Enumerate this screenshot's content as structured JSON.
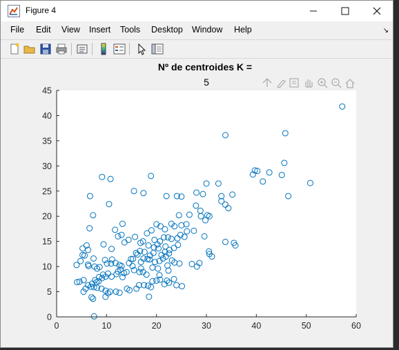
{
  "window": {
    "title": "Figure 4",
    "minimize_icon": "minimize-icon",
    "maximize_icon": "maximize-icon",
    "close_icon": "close-icon"
  },
  "menubar": {
    "items": [
      "File",
      "Edit",
      "View",
      "Insert",
      "Tools",
      "Desktop",
      "Window",
      "Help"
    ],
    "dock_arrow": "↘"
  },
  "toolbar": {
    "icons": [
      "new-figure-icon",
      "open-file-icon",
      "save-icon",
      "print-icon",
      "link-plot-icon",
      "insert-colorbar-icon",
      "insert-legend-icon",
      "edit-plot-icon",
      "property-inspector-icon"
    ]
  },
  "axes_toolbar": {
    "icons": [
      "export-icon",
      "brush-icon",
      "data-tips-icon",
      "pan-icon",
      "zoom-in-icon",
      "zoom-out-icon",
      "home-icon"
    ]
  },
  "colors": {
    "marker": "#0072BD",
    "axes_bg": "#ffffff",
    "figure_bg": "#f0f0f0"
  },
  "chart_data": {
    "type": "scatter",
    "title": "Nº de centroides K =",
    "subtitle": "5",
    "xlim": [
      0,
      60
    ],
    "ylim": [
      0,
      45
    ],
    "xticks": [
      "0",
      "10",
      "20",
      "30",
      "40",
      "50",
      "60"
    ],
    "yticks": [
      "0",
      "5",
      "10",
      "15",
      "20",
      "25",
      "30",
      "35",
      "40",
      "45"
    ],
    "marker": "open-circle",
    "points": [
      [
        57.2,
        41.8
      ],
      [
        45.8,
        36.5
      ],
      [
        33.8,
        36.1
      ],
      [
        45.6,
        30.6
      ],
      [
        39.7,
        29.1
      ],
      [
        40.2,
        29.0
      ],
      [
        42.6,
        28.7
      ],
      [
        39.3,
        28.3
      ],
      [
        45.1,
        28.2
      ],
      [
        30.0,
        26.5
      ],
      [
        32.4,
        26.5
      ],
      [
        41.3,
        26.9
      ],
      [
        50.8,
        26.6
      ],
      [
        33.0,
        24.0
      ],
      [
        35.2,
        24.3
      ],
      [
        46.4,
        24.0
      ],
      [
        33.0,
        23.0
      ],
      [
        33.8,
        22.3
      ],
      [
        34.4,
        21.6
      ],
      [
        28.0,
        24.7
      ],
      [
        29.3,
        24.4
      ],
      [
        27.9,
        22.1
      ],
      [
        28.8,
        21.1
      ],
      [
        28.9,
        20.0
      ],
      [
        30.2,
        20.2
      ],
      [
        29.8,
        19.2
      ],
      [
        30.6,
        20.0
      ],
      [
        29.6,
        16.0
      ],
      [
        33.8,
        14.9
      ],
      [
        35.5,
        14.7
      ],
      [
        35.8,
        14.2
      ],
      [
        30.6,
        12.5
      ],
      [
        30.5,
        13.0
      ],
      [
        31.1,
        12.0
      ],
      [
        28.6,
        10.7
      ],
      [
        28.1,
        10.0
      ],
      [
        27.1,
        10.5
      ],
      [
        25.0,
        23.9
      ],
      [
        24.1,
        24.0
      ],
      [
        22.0,
        24.0
      ],
      [
        17.4,
        24.6
      ],
      [
        15.5,
        25.0
      ],
      [
        18.9,
        28.0
      ],
      [
        9.1,
        27.8
      ],
      [
        10.8,
        27.4
      ],
      [
        6.7,
        24.0
      ],
      [
        10.5,
        22.4
      ],
      [
        7.3,
        20.2
      ],
      [
        6.6,
        17.6
      ],
      [
        11.7,
        17.3
      ],
      [
        13.2,
        18.5
      ],
      [
        20.0,
        18.4
      ],
      [
        20.8,
        18.0
      ],
      [
        21.7,
        17.4
      ],
      [
        23.0,
        18.5
      ],
      [
        23.6,
        18.0
      ],
      [
        25.0,
        18.2
      ],
      [
        26.0,
        18.4
      ],
      [
        24.5,
        20.2
      ],
      [
        26.6,
        20.3
      ],
      [
        27.5,
        17.1
      ],
      [
        26.1,
        17.0
      ],
      [
        24.8,
        16.3
      ],
      [
        25.6,
        15.9
      ],
      [
        24.2,
        15.6
      ],
      [
        23.0,
        15.5
      ],
      [
        22.3,
        15.8
      ],
      [
        21.5,
        15.8
      ],
      [
        20.7,
        15.0
      ],
      [
        20.2,
        14.4
      ],
      [
        19.6,
        15.3
      ],
      [
        19.0,
        17.2
      ],
      [
        18.1,
        16.6
      ],
      [
        17.3,
        15.0
      ],
      [
        16.8,
        14.7
      ],
      [
        18.4,
        14.2
      ],
      [
        19.5,
        13.8
      ],
      [
        20.4,
        13.6
      ],
      [
        21.8,
        14.0
      ],
      [
        22.6,
        13.3
      ],
      [
        23.5,
        13.7
      ],
      [
        24.3,
        14.3
      ],
      [
        21.0,
        12.3
      ],
      [
        21.7,
        12.9
      ],
      [
        22.5,
        12.6
      ],
      [
        23.1,
        11.2
      ],
      [
        23.6,
        10.8
      ],
      [
        24.6,
        10.6
      ],
      [
        22.2,
        10.2
      ],
      [
        22.4,
        9.2
      ],
      [
        20.3,
        9.6
      ],
      [
        19.2,
        9.8
      ],
      [
        18.6,
        11.4
      ],
      [
        18.2,
        11.5
      ],
      [
        17.4,
        11.6
      ],
      [
        16.9,
        10.9
      ],
      [
        16.2,
        12.4
      ],
      [
        15.9,
        12.7
      ],
      [
        16.7,
        13.1
      ],
      [
        17.6,
        12.9
      ],
      [
        19.4,
        12.7
      ],
      [
        18.7,
        12.2
      ],
      [
        15.7,
        15.9
      ],
      [
        14.4,
        15.3
      ],
      [
        13.6,
        14.8
      ],
      [
        12.3,
        16.0
      ],
      [
        13.0,
        16.3
      ],
      [
        11.0,
        13.5
      ],
      [
        9.4,
        14.4
      ],
      [
        6.0,
        14.2
      ],
      [
        5.2,
        13.6
      ],
      [
        6.3,
        13.3
      ],
      [
        7.4,
        11.6
      ],
      [
        5.2,
        12.3
      ],
      [
        4.8,
        11.1
      ],
      [
        5.6,
        12.2
      ],
      [
        4.0,
        10.3
      ],
      [
        6.3,
        10.4
      ],
      [
        7.6,
        10.0
      ],
      [
        9.7,
        11.3
      ],
      [
        10.1,
        10.6
      ],
      [
        10.9,
        10.6
      ],
      [
        11.1,
        11.4
      ],
      [
        11.8,
        10.7
      ],
      [
        12.6,
        10.3
      ],
      [
        13.0,
        10.1
      ],
      [
        14.5,
        10.7
      ],
      [
        14.9,
        11.5
      ],
      [
        15.3,
        11.5
      ],
      [
        15.2,
        10.1
      ],
      [
        13.5,
        8.7
      ],
      [
        13.2,
        7.9
      ],
      [
        12.3,
        9.0
      ],
      [
        12.0,
        8.5
      ],
      [
        11.0,
        8.0
      ],
      [
        10.3,
        8.6
      ],
      [
        9.8,
        8.0
      ],
      [
        9.3,
        8.4
      ],
      [
        9.1,
        7.7
      ],
      [
        8.5,
        7.9
      ],
      [
        8.4,
        7.1
      ],
      [
        8.0,
        6.9
      ],
      [
        7.7,
        7.3
      ],
      [
        7.1,
        6.6
      ],
      [
        6.9,
        6.0
      ],
      [
        6.3,
        6.3
      ],
      [
        5.8,
        5.6
      ],
      [
        5.4,
        7.3
      ],
      [
        4.6,
        7.0
      ],
      [
        4.1,
        6.9
      ],
      [
        7.5,
        5.9
      ],
      [
        8.1,
        5.8
      ],
      [
        9.0,
        5.6
      ],
      [
        9.8,
        5.2
      ],
      [
        10.3,
        4.7
      ],
      [
        10.7,
        5.0
      ],
      [
        11.9,
        5.0
      ],
      [
        12.6,
        4.8
      ],
      [
        14.1,
        5.6
      ],
      [
        14.6,
        5.3
      ],
      [
        16.0,
        5.6
      ],
      [
        16.5,
        6.3
      ],
      [
        17.5,
        6.3
      ],
      [
        18.3,
        6.2
      ],
      [
        18.9,
        5.9
      ],
      [
        19.2,
        7.1
      ],
      [
        20.0,
        7.2
      ],
      [
        20.7,
        7.4
      ],
      [
        22.1,
        7.2
      ],
      [
        22.5,
        6.8
      ],
      [
        23.5,
        7.5
      ],
      [
        24.0,
        6.3
      ],
      [
        25.1,
        6.1
      ],
      [
        21.6,
        6.5
      ],
      [
        20.6,
        8.3
      ],
      [
        18.0,
        8.4
      ],
      [
        16.6,
        8.9
      ],
      [
        15.5,
        9.3
      ],
      [
        14.0,
        8.9
      ],
      [
        7.0,
        3.9
      ],
      [
        7.3,
        3.6
      ],
      [
        9.8,
        4.0
      ],
      [
        18.5,
        4.0
      ],
      [
        7.5,
        0.1
      ],
      [
        5.4,
        5.0
      ],
      [
        6.4,
        10.1
      ],
      [
        8.1,
        9.6
      ],
      [
        8.6,
        9.9
      ],
      [
        12.8,
        9.4
      ],
      [
        16.9,
        9.6
      ],
      [
        17.3,
        8.9
      ],
      [
        19.7,
        10.9
      ],
      [
        20.6,
        11.1
      ],
      [
        21.3,
        11.6
      ],
      [
        21.9,
        12.0
      ]
    ]
  }
}
